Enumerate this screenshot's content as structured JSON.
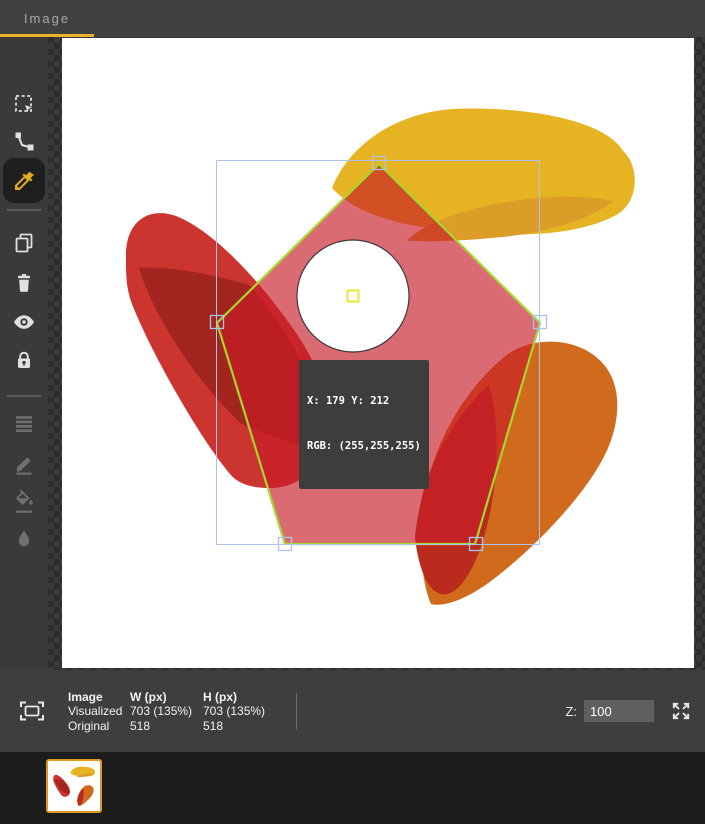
{
  "header": {
    "tab_label": "Image",
    "accent_color": "#e9b42c"
  },
  "toolbar": {
    "active_tool": "eyedropper",
    "tools": [
      "rect-select",
      "polyline-select",
      "eyedropper",
      "copy",
      "delete",
      "visibility",
      "lock",
      "layers",
      "draw",
      "fill",
      "blur"
    ]
  },
  "canvas": {
    "tooltip": {
      "line1": "X: 179 Y: 212",
      "line2": "RGB: (255,255,255)"
    },
    "colors": {
      "blob_yellow": "#e6b422",
      "blob_yellow_dark": "#db9c28",
      "blob_red": "#cc3430",
      "blob_red_dark": "#a32520",
      "blob_orange": "#d06b1d",
      "blob_orange_dark": "#b92b1d",
      "polygon_fill": "rgba(199,28,38,0.65)",
      "polygon_stroke": "#a5d72c",
      "selection_stroke": "#adc3e9",
      "probe_stroke": "#f0e43a"
    }
  },
  "status_bar": {
    "table": {
      "headers": [
        "Image",
        "W (px)",
        "H (px)"
      ],
      "rows": [
        [
          "Visualized",
          "703 (135%)",
          "703 (135%)"
        ],
        [
          "Original",
          "518",
          "518"
        ]
      ]
    },
    "zoom_label": "Z:",
    "zoom_value": "100"
  }
}
